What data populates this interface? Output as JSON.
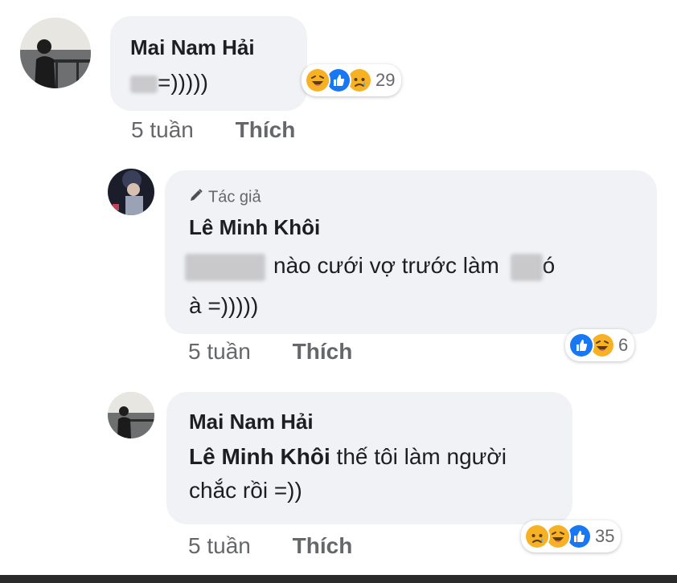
{
  "comments": [
    {
      "author": "Mai Nam Hải",
      "text": "=)))))",
      "time": "5 tuần",
      "like_label": "Thích",
      "reaction_count": "29",
      "reactions": [
        "haha-icon",
        "like-icon",
        "sad-icon"
      ]
    },
    {
      "badge": "Tác giả",
      "author": "Lê Minh Khôi",
      "text_line1": "nào cưới vợ trước làm",
      "text_line1_end": "ó",
      "text_line2": "à =)))))",
      "time": "5 tuần",
      "like_label": "Thích",
      "reaction_count": "6",
      "reactions": [
        "like-icon",
        "haha-icon"
      ]
    },
    {
      "author": "Mai Nam Hải",
      "mention": "Lê Minh Khôi",
      "text_line1": "thế tôi làm người",
      "text_line2": "chắc rồi =))",
      "time": "5 tuần",
      "like_label": "Thích",
      "reaction_count": "35",
      "reactions": [
        "sad-icon",
        "haha-icon",
        "like-icon"
      ]
    }
  ],
  "colors": {
    "bubble": "#f0f2f5",
    "like": "#1877f2",
    "emoji": "#f7b125",
    "meta": "#65676b"
  }
}
